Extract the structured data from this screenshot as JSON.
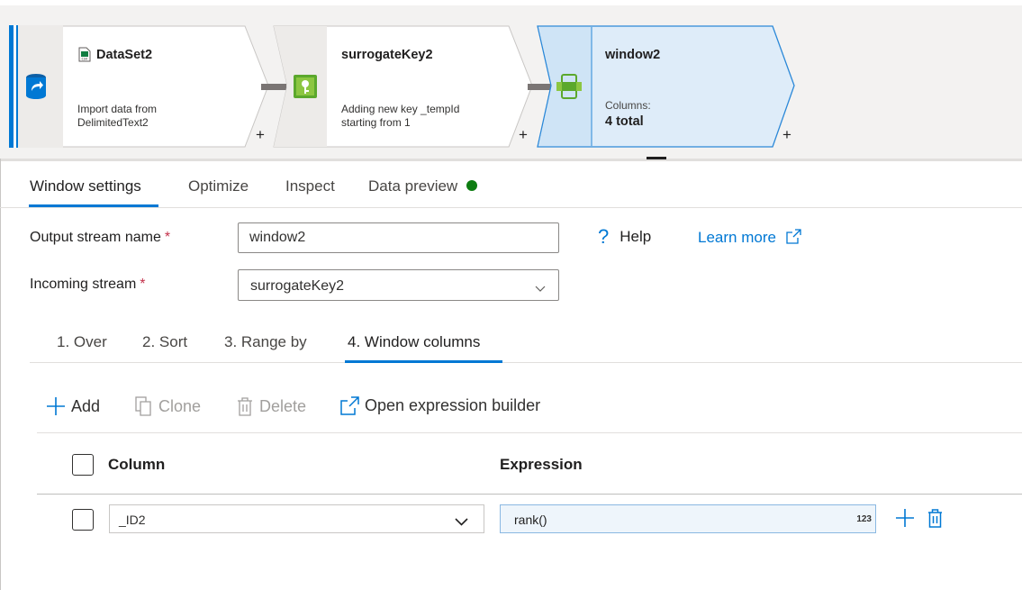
{
  "pipeline": {
    "nodes": [
      {
        "title": "DataSet2",
        "desc_line1": "Import data from",
        "desc_line2": "DelimitedText2",
        "icon": "database-source-icon",
        "title_icon": "csv-file-icon",
        "add": "+"
      },
      {
        "title": "surrogateKey2",
        "desc_line1": "Adding new key _tempId",
        "desc_line2": "starting from 1",
        "icon": "surrogate-key-icon",
        "add": "+"
      },
      {
        "title": "window2",
        "desc_line1": "Columns:",
        "desc_line2": "4 total",
        "icon": "window-icon",
        "add": "+",
        "selected": true
      }
    ]
  },
  "tabs": [
    {
      "label": "Window settings",
      "active": true
    },
    {
      "label": "Optimize"
    },
    {
      "label": "Inspect"
    },
    {
      "label": "Data preview",
      "status": "ready"
    }
  ],
  "form": {
    "output_stream_label": "Output stream name",
    "output_stream_value": "window2",
    "incoming_stream_label": "Incoming stream",
    "incoming_stream_value": "surrogateKey2",
    "required_mark": "*",
    "help_label": "Help",
    "help_glyph": "?",
    "learn_more_label": "Learn more"
  },
  "subtabs": [
    {
      "label": "1. Over"
    },
    {
      "label": "2. Sort"
    },
    {
      "label": "3. Range by"
    },
    {
      "label": "4. Window columns",
      "active": true
    }
  ],
  "toolbar": {
    "add_label": "Add",
    "clone_label": "Clone",
    "delete_label": "Delete",
    "expression_builder_label": "Open expression builder"
  },
  "grid": {
    "column_header": "Column",
    "expression_header": "Expression",
    "rows": [
      {
        "column": "_ID2",
        "expression": "rank()",
        "type_badge": "123"
      }
    ]
  },
  "colors": {
    "accent": "#0078d4",
    "status_ok": "#0e7d12",
    "required": "#c4314b",
    "selected_node_fill": "#deecf9"
  }
}
